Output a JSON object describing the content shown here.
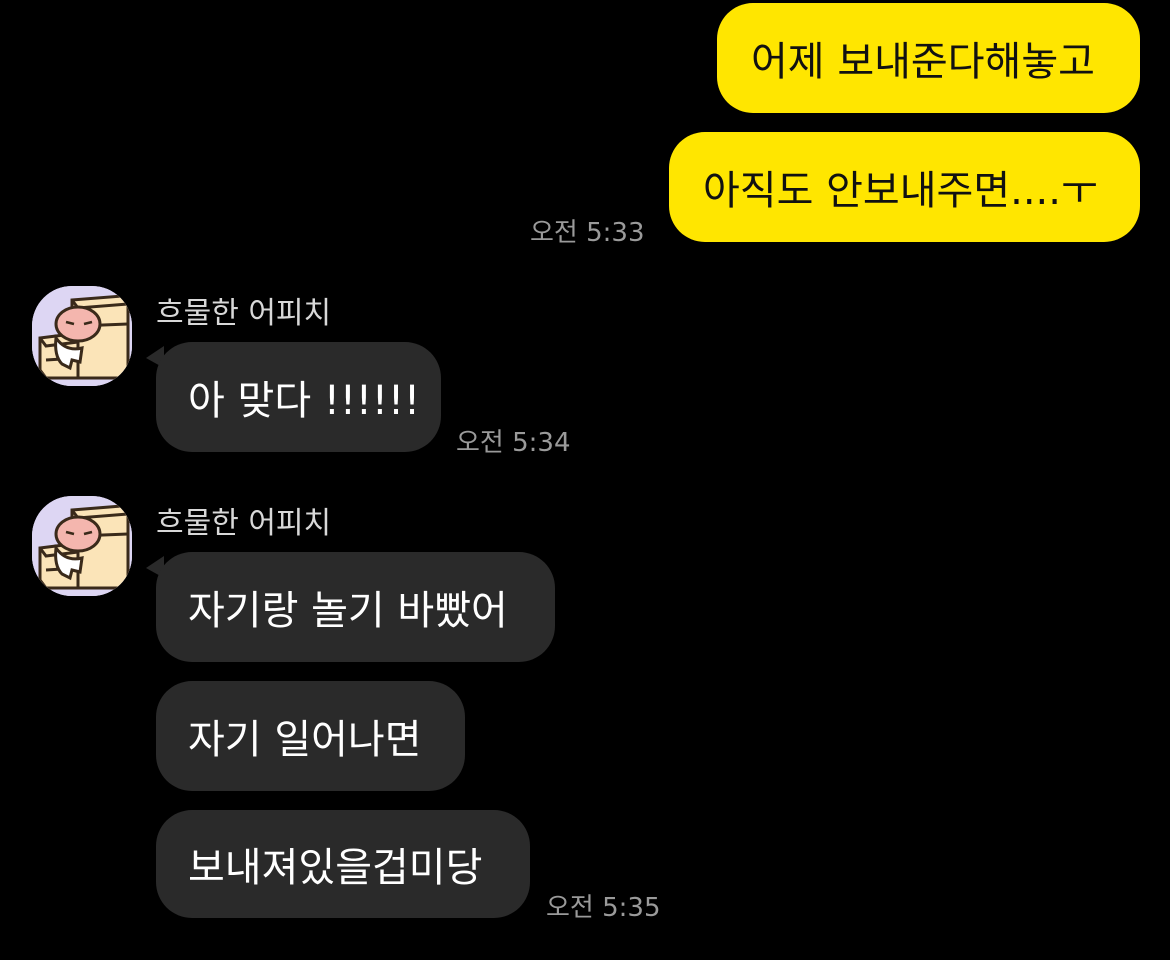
{
  "conversation": {
    "outgoing": [
      {
        "text": "어제 보내준다해놓고"
      },
      {
        "text": "아직도 안보내주면....ㅜ"
      }
    ],
    "outgoing_time": "오전 5:33",
    "incoming_groups": [
      {
        "sender": "흐물한 어피치",
        "messages": [
          {
            "text": "아 맞다 !!!!!!"
          }
        ],
        "time": "오전 5:34"
      },
      {
        "sender": "흐물한 어피치",
        "messages": [
          {
            "text": "자기랑 놀기 바빴어"
          },
          {
            "text": "자기 일어나면"
          },
          {
            "text": "보내져있을겁미당"
          }
        ],
        "time": "오전 5:35"
      }
    ]
  },
  "avatar_icon": "apeach-stairs-icon",
  "colors": {
    "background": "#000000",
    "outgoing_bubble": "#ffe600",
    "incoming_bubble": "#2a2a2a",
    "timestamp": "#9a9a9a",
    "avatar_bg": "#ddd6f3"
  }
}
